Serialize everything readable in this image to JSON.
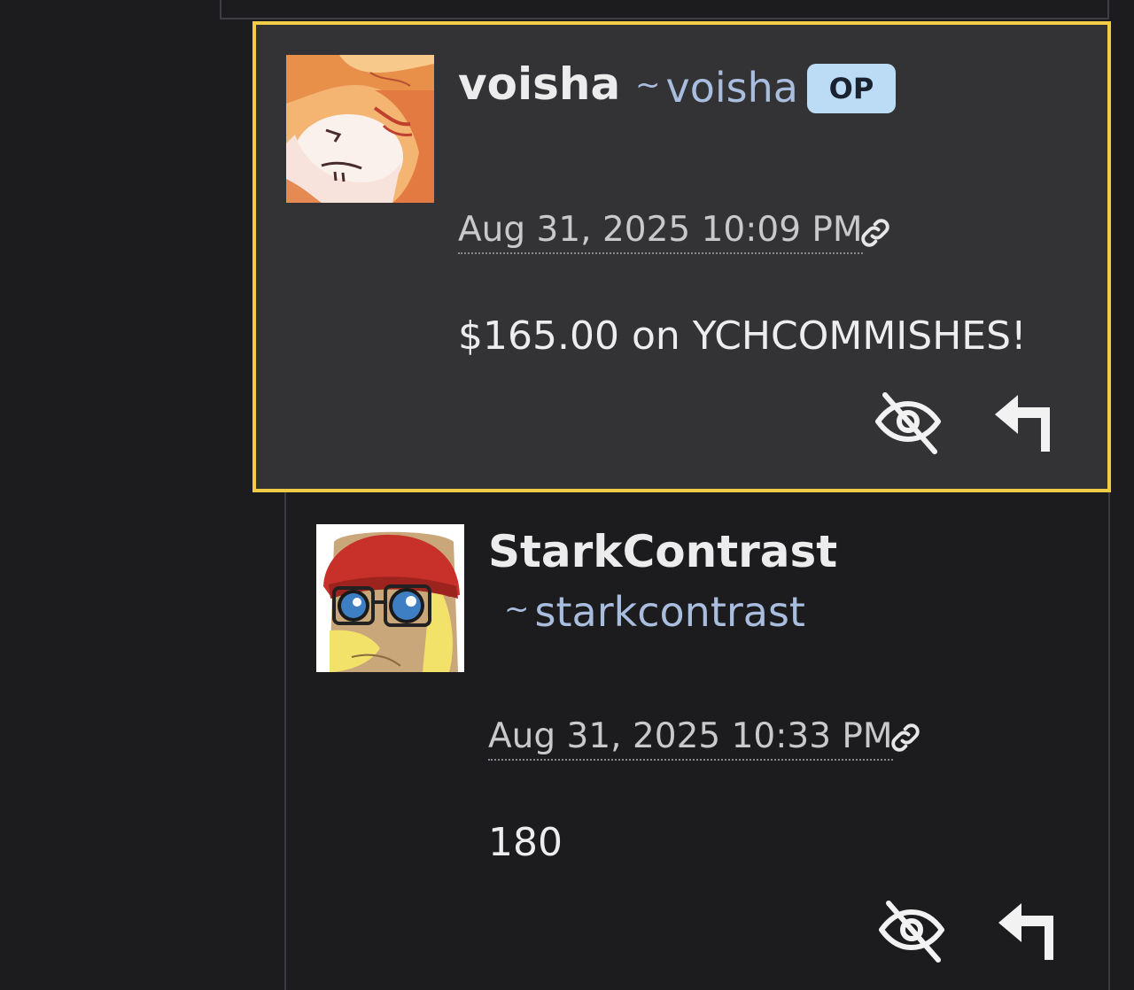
{
  "comments": [
    {
      "username": "voisha",
      "handle": "voisha",
      "badge": "OP",
      "timestamp": "Aug 31, 2025 10:09 PM",
      "body": "$165.00 on YCHCOMMISHES!",
      "highlighted": true
    },
    {
      "username": "StarkContrast",
      "handle": "starkcontrast",
      "timestamp": "Aug 31, 2025 10:33 PM",
      "body": "180",
      "highlighted": false
    }
  ],
  "icons": {
    "permalink": "link-icon",
    "hide": "eye-slash-icon",
    "reply": "reply-arrow-icon"
  },
  "colors": {
    "highlight_border": "#f1cc47",
    "op_badge": "#bcdcf6",
    "handle": "#a9bede",
    "comment_bg": "#333335",
    "page_bg": "#1c1c1e"
  }
}
